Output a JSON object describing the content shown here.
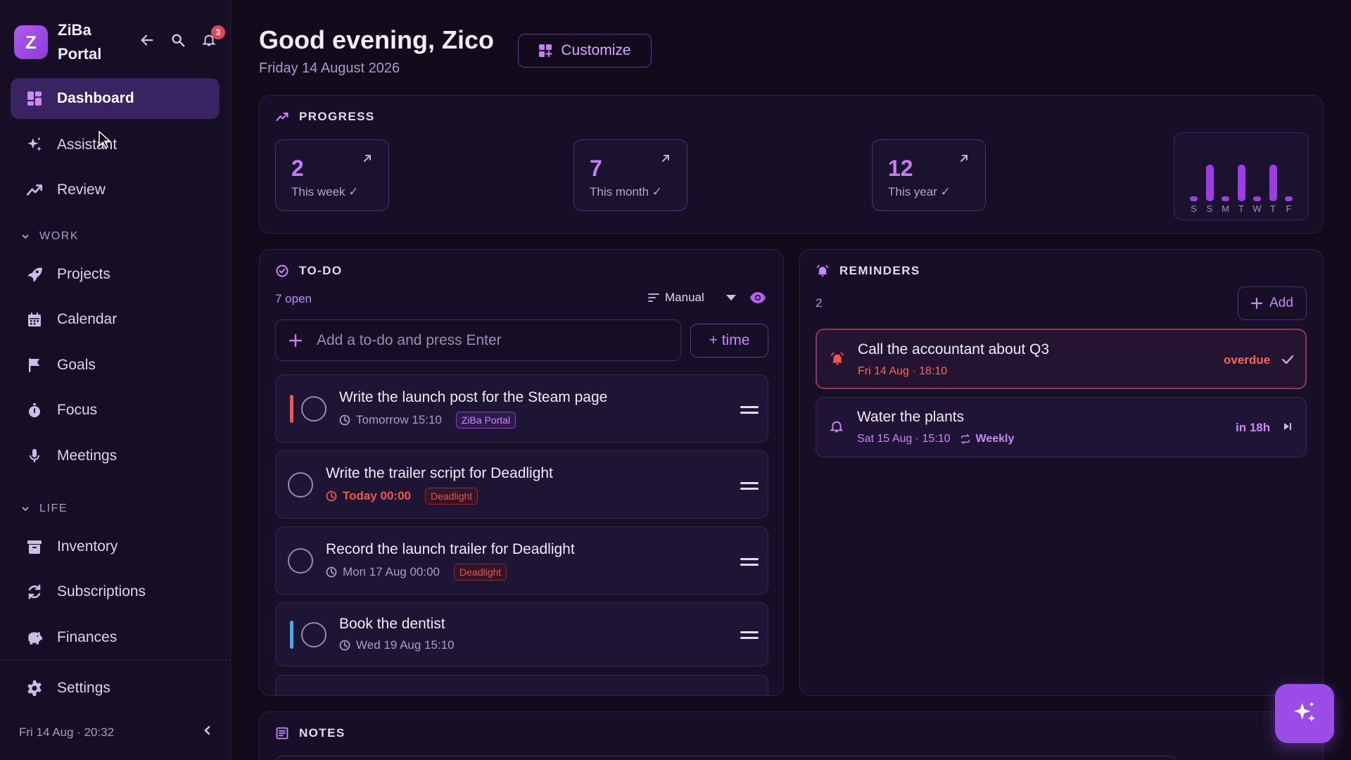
{
  "app": {
    "logo_letter": "Z",
    "name": "ZiBa Portal",
    "notifications_count": "3"
  },
  "sidebar": {
    "top_items": [
      {
        "label": "Dashboard",
        "icon": "dashboard-icon",
        "active": true
      },
      {
        "label": "Assistant",
        "icon": "sparkles-icon"
      },
      {
        "label": "Review",
        "icon": "trend-icon"
      }
    ],
    "work_section": "WORK",
    "work_items": [
      {
        "label": "Projects",
        "icon": "rocket-icon"
      },
      {
        "label": "Calendar",
        "icon": "calendar-icon"
      },
      {
        "label": "Goals",
        "icon": "flag-icon"
      },
      {
        "label": "Focus",
        "icon": "stopwatch-icon"
      },
      {
        "label": "Meetings",
        "icon": "microphone-icon"
      }
    ],
    "life_section": "LIFE",
    "life_items": [
      {
        "label": "Inventory",
        "icon": "archive-icon"
      },
      {
        "label": "Subscriptions",
        "icon": "refresh-icon"
      },
      {
        "label": "Finances",
        "icon": "piggy-bank-icon"
      }
    ],
    "settings_label": "Settings",
    "footer_datetime": "Fri 14 Aug · 20:32"
  },
  "header": {
    "greeting": "Good evening, Zico",
    "date": "Friday 14 August 2026",
    "customize_label": "Customize"
  },
  "progress": {
    "title": "PROGRESS",
    "stats": [
      {
        "value": "2",
        "label": "This week ✓"
      },
      {
        "value": "7",
        "label": "This month ✓"
      },
      {
        "value": "12",
        "label": "This year ✓"
      }
    ],
    "week_bars": {
      "days": [
        "S",
        "S",
        "M",
        "T",
        "W",
        "T",
        "F"
      ],
      "values": [
        0.1,
        1.0,
        0.1,
        1.0,
        0.1,
        1.0,
        0.1
      ]
    }
  },
  "todo": {
    "title": "TO-DO",
    "open_count": "7 open",
    "sort_label": "Manual",
    "input_placeholder": "Add a to-do and press Enter",
    "time_button": "+ time",
    "items": [
      {
        "title": "Write the launch post for the Steam page",
        "due": "Tomorrow 15:10",
        "tag": "ZiBa Portal",
        "tag_style": "purple",
        "priority_color": "#f0584e",
        "overdue": false
      },
      {
        "title": "Write the trailer script for Deadlight",
        "due": "Today 00:00",
        "tag": "Deadlight",
        "tag_style": "red",
        "priority_color": "",
        "overdue": true
      },
      {
        "title": "Record the launch trailer for Deadlight",
        "due": "Mon 17 Aug 00:00",
        "tag": "Deadlight",
        "tag_style": "red",
        "priority_color": "",
        "overdue": false
      },
      {
        "title": "Book the dentist",
        "due": "Wed 19 Aug 15:10",
        "tag": "",
        "tag_style": "",
        "priority_color": "#4aa8f0",
        "overdue": false
      }
    ]
  },
  "reminders": {
    "title": "REMINDERS",
    "count": "2",
    "add_label": "Add",
    "items": [
      {
        "title": "Call the accountant about Q3",
        "when": "Fri 14 Aug · 18:10",
        "repeat": "",
        "status": "overdue",
        "status_color": "#f06a5a"
      },
      {
        "title": "Water the plants",
        "when": "Sat 15 Aug · 15:10",
        "repeat": "Weekly",
        "status": "in 18h",
        "status_color": "#c986f6"
      }
    ]
  },
  "notes": {
    "title": "NOTES"
  },
  "colors": {
    "accent": "#c47df3",
    "background": "#110b1c",
    "danger": "#f0584e"
  }
}
